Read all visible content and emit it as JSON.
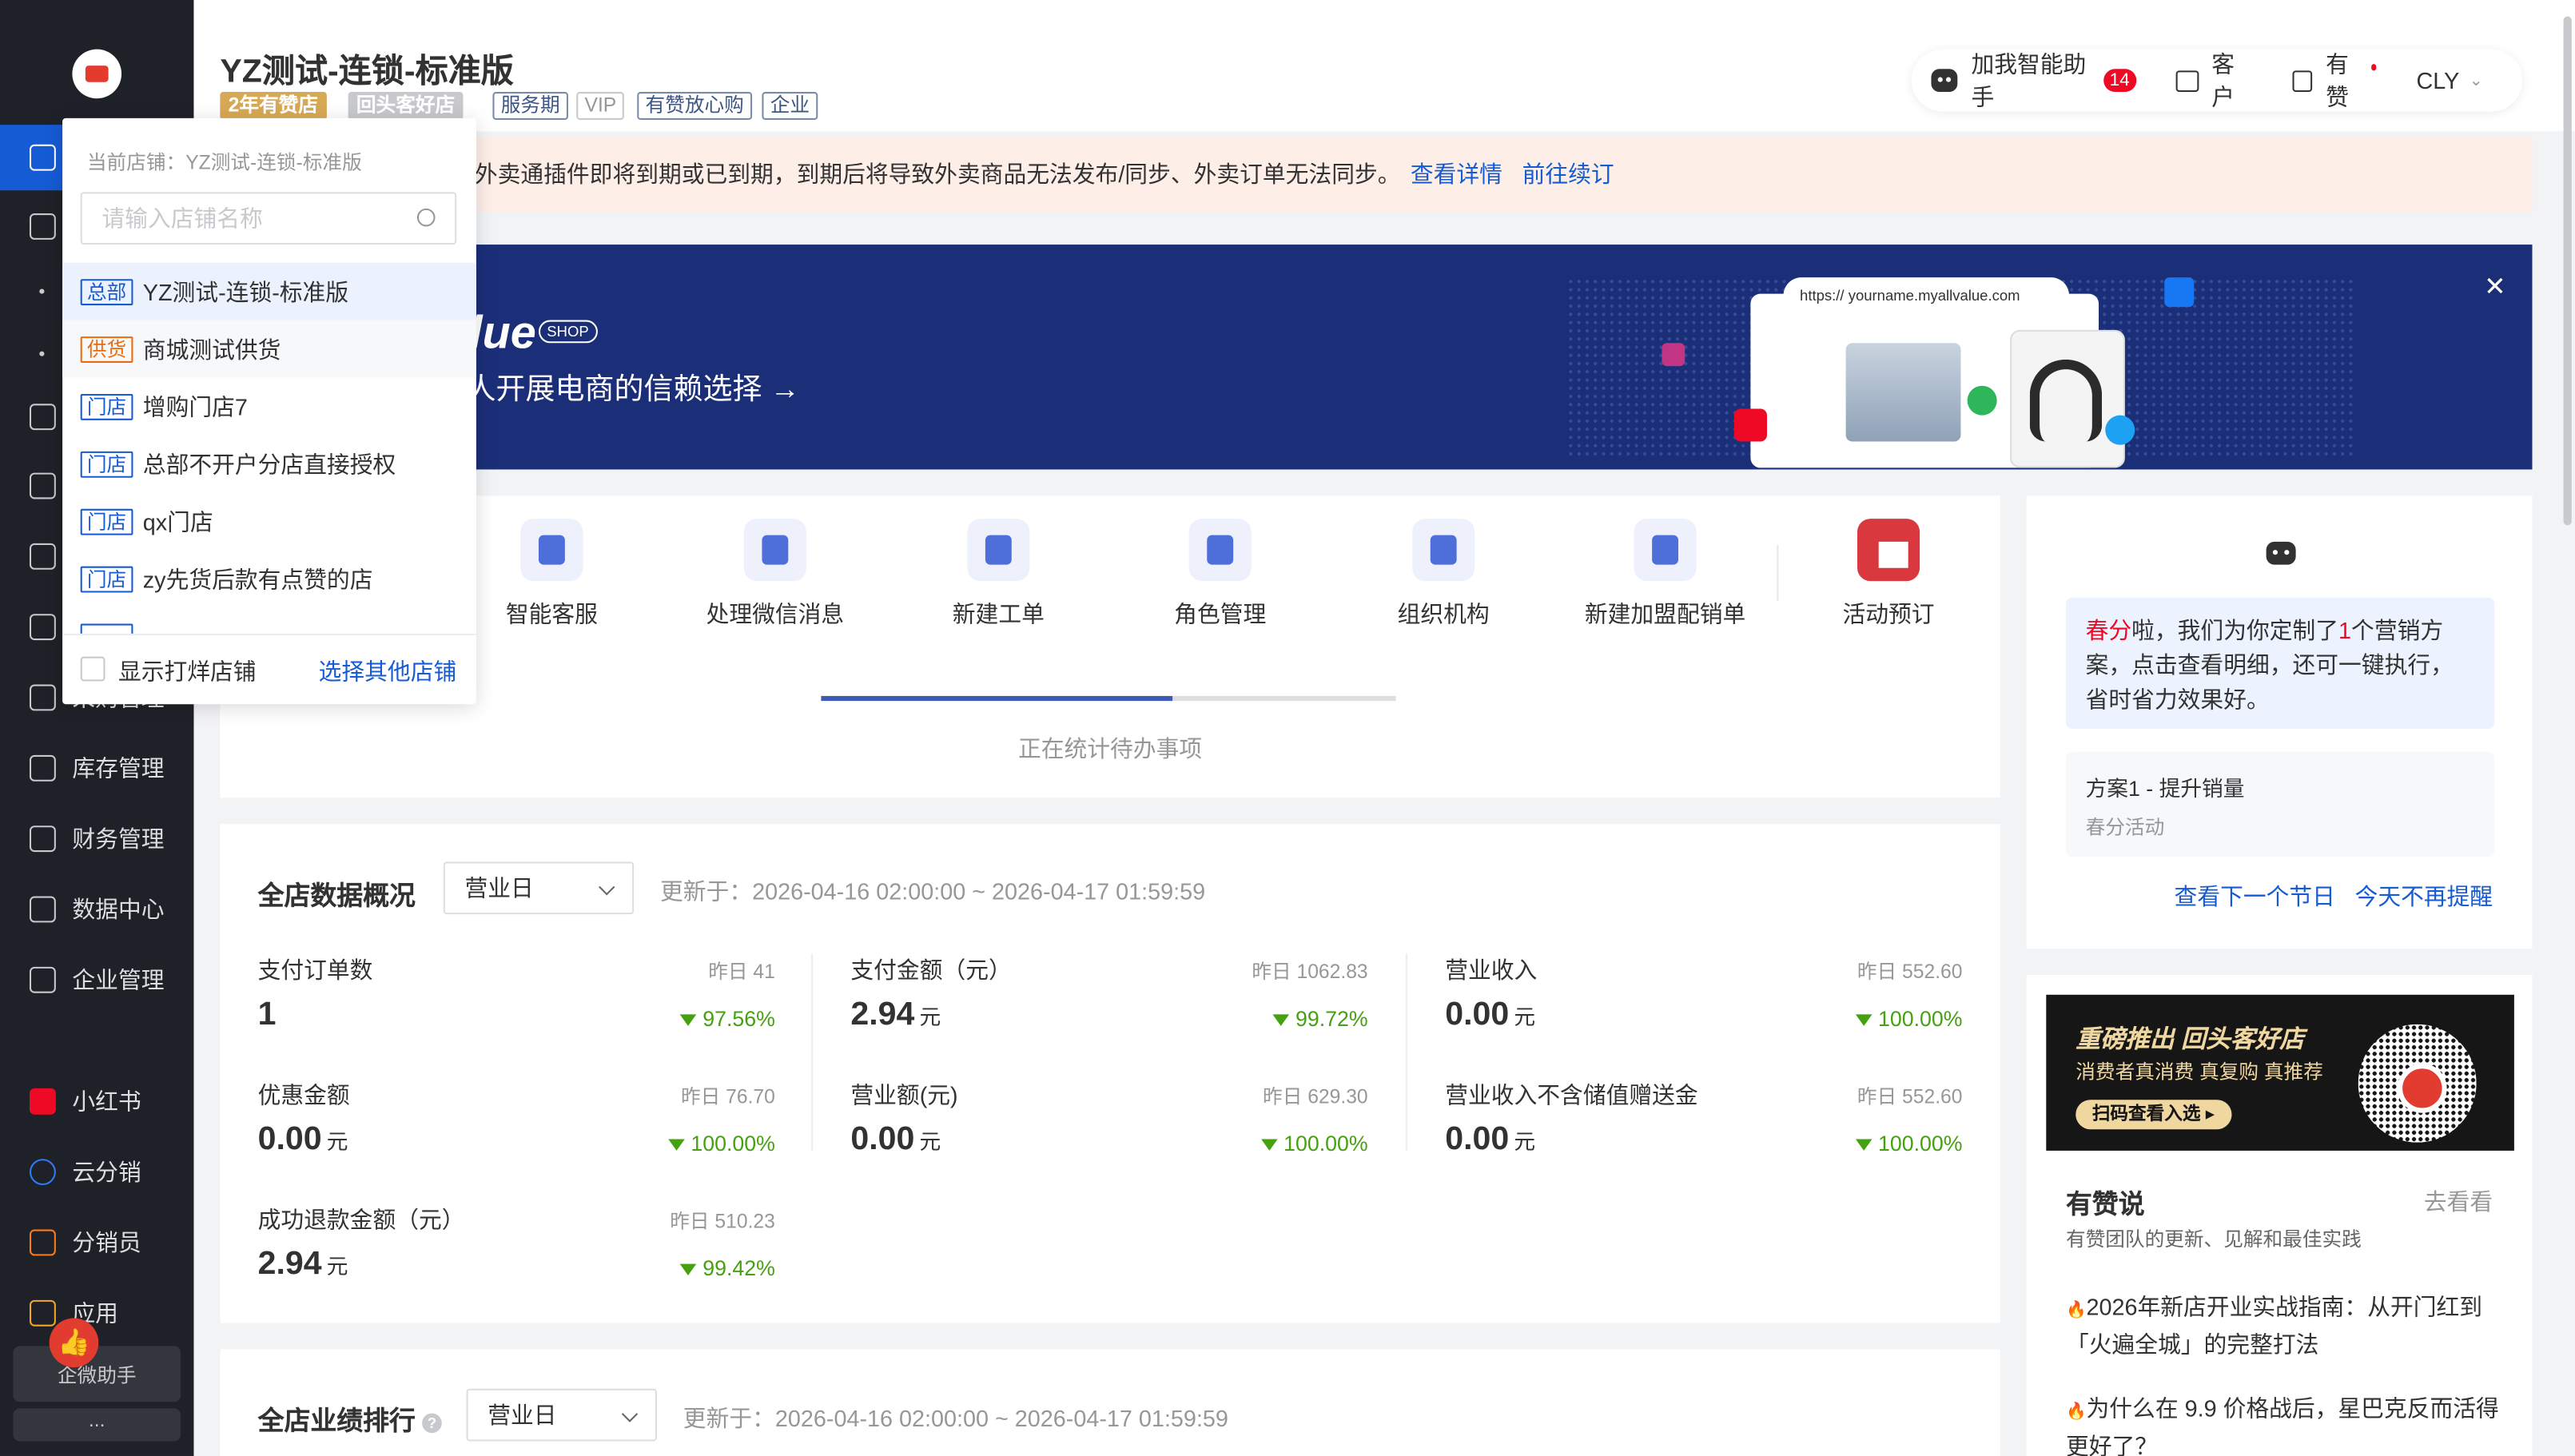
{
  "sidebar": {
    "items": [
      {
        "label": "库存管理"
      },
      {
        "label": "财务管理"
      },
      {
        "label": "数据中心"
      },
      {
        "label": "企业管理"
      },
      {
        "label": "小红书"
      },
      {
        "label": "云分销"
      },
      {
        "label": "分销员"
      },
      {
        "label": "应用"
      }
    ],
    "partial_label": "采购管理",
    "wecom_label": "企微助手",
    "more_label": "..."
  },
  "header": {
    "store_name": "YZ测试-连锁-标准版",
    "tags": [
      "2年有赞店",
      "回头客好店",
      "服务期",
      "VIP",
      "有赞放心购",
      "企业"
    ],
    "assistant_label": "加我智能助手",
    "assistant_badge": "14",
    "customer_label": "客户",
    "youzan_label": "有赞",
    "user_label": "CLY"
  },
  "alert": {
    "text": "外卖通插件即将到期或已到期，到期后将导致外卖商品无法发布/同步、外卖订单无法同步。",
    "link_detail": "查看详情",
    "link_renew": "前往续订"
  },
  "banner": {
    "brand": "lue",
    "shop_tag": "SHOP",
    "subtitle": "人开展电商的信赖选择 →",
    "url": "https://  yourname.myallvalue.com",
    "close": "✕"
  },
  "quick_actions": [
    {
      "label": "智能客服"
    },
    {
      "label": "处理微信消息"
    },
    {
      "label": "新建工单"
    },
    {
      "label": "角色管理"
    },
    {
      "label": "组织机构"
    },
    {
      "label": "新建加盟配销单"
    },
    {
      "label": "活动预订"
    }
  ],
  "todo": {
    "text": "正在统计待办事项",
    "progress": 0.61
  },
  "overview": {
    "title": "全店数据概况",
    "period": "营业日",
    "updated": "更新于：2026-04-16 02:00:00 ~ 2026-04-17 01:59:59",
    "metrics": [
      {
        "label": "支付订单数",
        "yesterday": "昨日 41",
        "value": "1",
        "unit": "",
        "change": "97.56%"
      },
      {
        "label": "支付金额（元）",
        "yesterday": "昨日 1062.83",
        "value": "2.94",
        "unit": "元",
        "change": "99.72%"
      },
      {
        "label": "营业收入",
        "yesterday": "昨日 552.60",
        "value": "0.00",
        "unit": "元",
        "change": "100.00%"
      },
      {
        "label": "优惠金额",
        "yesterday": "昨日 76.70",
        "value": "0.00",
        "unit": "元",
        "change": "100.00%"
      },
      {
        "label": "营业额(元)",
        "yesterday": "昨日 629.30",
        "value": "0.00",
        "unit": "元",
        "change": "100.00%"
      },
      {
        "label": "营业收入不含储值赠送金",
        "yesterday": "昨日 552.60",
        "value": "0.00",
        "unit": "元",
        "change": "100.00%"
      },
      {
        "label": "成功退款金额（元）",
        "yesterday": "昨日 510.23",
        "value": "2.94",
        "unit": "元",
        "change": "99.42%"
      }
    ]
  },
  "ranking": {
    "title": "全店业绩排行",
    "period": "营业日",
    "updated": "更新于：2026-04-16 02:00:00 ~ 2026-04-17 01:59:59"
  },
  "marketing": {
    "greeting_pre": "春分",
    "greeting_mid": "啦，我们为你定制了",
    "greeting_num": "1",
    "greeting_post": "个营销方案，点击查看明细，还可一键执行，省时省力效果好。",
    "plan_title": "方案1 - 提升销量",
    "plan_sub": "春分活动",
    "link_next": "查看下一个节日",
    "link_dismiss": "今天不再提醒"
  },
  "promo": {
    "headline": "重磅推出 回头客好店",
    "sub": "消费者真消费 真复购 真推荐",
    "button": "扫码查看入选 ▸"
  },
  "youzan_says": {
    "title": "有赞说",
    "more": "去看看",
    "subtitle": "有赞团队的更新、见解和最佳实践",
    "articles": [
      "2026年新店开业实战指南：从开门红到「火遍全城」的完整打法",
      "为什么在 9.9 价格战后，星巴克反而活得更好了？"
    ]
  },
  "store_dropdown": {
    "current": "当前店铺：YZ测试-连锁-标准版",
    "search_placeholder": "请输入店铺名称",
    "stores": [
      {
        "tag": "总部",
        "name": "YZ测试-连锁-标准版"
      },
      {
        "tag": "供货",
        "name": "商城测试供货"
      },
      {
        "tag": "门店",
        "name": "增购门店7"
      },
      {
        "tag": "门店",
        "name": "总部不开户分店直接授权"
      },
      {
        "tag": "门店",
        "name": "qx门店"
      },
      {
        "tag": "门店",
        "name": "zy先货后款有点赞的店"
      }
    ],
    "show_sample": "显示打烊店铺",
    "select_other": "选择其他店铺"
  }
}
